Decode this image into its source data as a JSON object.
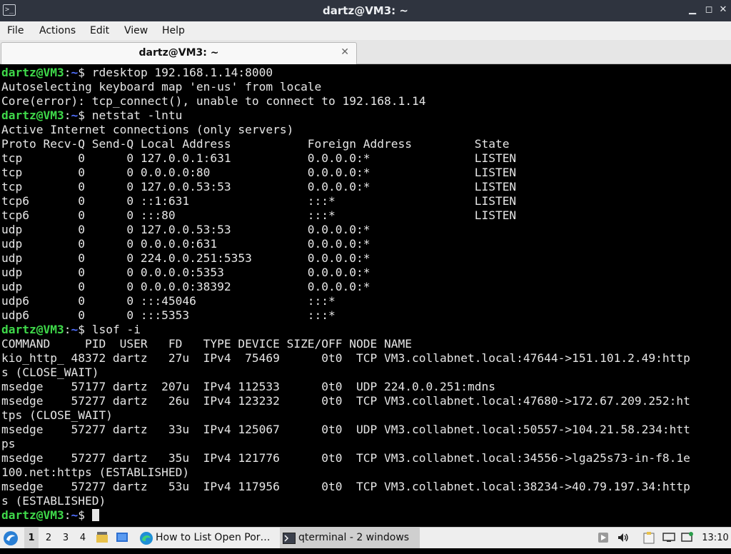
{
  "window": {
    "title": "dartz@VM3: ~",
    "app_icon_glyph": ">_",
    "min_glyph": "▁",
    "max_glyph": "◻",
    "close_glyph": "✕"
  },
  "menu": [
    "File",
    "Actions",
    "Edit",
    "View",
    "Help"
  ],
  "tab": {
    "label": "dartz@VM3: ~",
    "close_glyph": "✕"
  },
  "prompt": {
    "user": "dartz@VM3",
    "path": "~",
    "symbol": "$ "
  },
  "terminal": {
    "lines": [
      {
        "type": "prompt",
        "cmd": "rdesktop 192.168.1.14:8000"
      },
      {
        "type": "text",
        "text": "Autoselecting keyboard map 'en-us' from locale"
      },
      {
        "type": "text",
        "text": "Core(error): tcp_connect(), unable to connect to 192.168.1.14"
      },
      {
        "type": "prompt",
        "cmd": "netstat -lntu"
      },
      {
        "type": "text",
        "text": "Active Internet connections (only servers)"
      },
      {
        "type": "text",
        "text": "Proto Recv-Q Send-Q Local Address           Foreign Address         State"
      },
      {
        "type": "text",
        "text": "tcp        0      0 127.0.0.1:631           0.0.0.0:*               LISTEN"
      },
      {
        "type": "text",
        "text": "tcp        0      0 0.0.0.0:80              0.0.0.0:*               LISTEN"
      },
      {
        "type": "text",
        "text": "tcp        0      0 127.0.0.53:53           0.0.0.0:*               LISTEN"
      },
      {
        "type": "text",
        "text": "tcp6       0      0 ::1:631                 :::*                    LISTEN"
      },
      {
        "type": "text",
        "text": "tcp6       0      0 :::80                   :::*                    LISTEN"
      },
      {
        "type": "text",
        "text": "udp        0      0 127.0.0.53:53           0.0.0.0:*"
      },
      {
        "type": "text",
        "text": "udp        0      0 0.0.0.0:631             0.0.0.0:*"
      },
      {
        "type": "text",
        "text": "udp        0      0 224.0.0.251:5353        0.0.0.0:*"
      },
      {
        "type": "text",
        "text": "udp        0      0 0.0.0.0:5353            0.0.0.0:*"
      },
      {
        "type": "text",
        "text": "udp        0      0 0.0.0.0:38392           0.0.0.0:*"
      },
      {
        "type": "text",
        "text": "udp6       0      0 :::45046                :::*"
      },
      {
        "type": "text",
        "text": "udp6       0      0 :::5353                 :::*"
      },
      {
        "type": "prompt",
        "cmd": "lsof -i"
      },
      {
        "type": "text",
        "text": "COMMAND     PID  USER   FD   TYPE DEVICE SIZE/OFF NODE NAME"
      },
      {
        "type": "text",
        "text": "kio_http_ 48372 dartz   27u  IPv4  75469      0t0  TCP VM3.collabnet.local:47644->151.101.2.49:http"
      },
      {
        "type": "text",
        "text": "s (CLOSE_WAIT)"
      },
      {
        "type": "text",
        "text": "msedge    57177 dartz  207u  IPv4 112533      0t0  UDP 224.0.0.251:mdns"
      },
      {
        "type": "text",
        "text": "msedge    57277 dartz   26u  IPv4 123232      0t0  TCP VM3.collabnet.local:47680->172.67.209.252:ht"
      },
      {
        "type": "text",
        "text": "tps (CLOSE_WAIT)"
      },
      {
        "type": "text",
        "text": "msedge    57277 dartz   33u  IPv4 125067      0t0  UDP VM3.collabnet.local:50557->104.21.58.234:htt"
      },
      {
        "type": "text",
        "text": "ps"
      },
      {
        "type": "text",
        "text": "msedge    57277 dartz   35u  IPv4 121776      0t0  TCP VM3.collabnet.local:34556->lga25s73-in-f8.1e"
      },
      {
        "type": "text",
        "text": "100.net:https (ESTABLISHED)"
      },
      {
        "type": "text",
        "text": "msedge    57277 dartz   53u  IPv4 117956      0t0  TCP VM3.collabnet.local:38234->40.79.197.34:http"
      },
      {
        "type": "text",
        "text": "s (ESTABLISHED)"
      },
      {
        "type": "prompt",
        "cmd": "",
        "cursor": true
      }
    ]
  },
  "taskbar": {
    "workspaces": [
      "1",
      "2",
      "3",
      "4"
    ],
    "active_workspace": "1",
    "tasks": [
      {
        "label": "How to List Open Por…",
        "icon": "edge-browser-icon",
        "active": false
      },
      {
        "label": "qterminal - 2 windows",
        "icon": "terminal-icon",
        "active": true
      }
    ],
    "clock": "13:10"
  },
  "colors": {
    "prompt_user": "#3fd94a",
    "prompt_path": "#4f6fff",
    "terminal_bg": "#000000",
    "terminal_fg": "#e6e6e6",
    "titlebar_bg": "#2f343f"
  }
}
